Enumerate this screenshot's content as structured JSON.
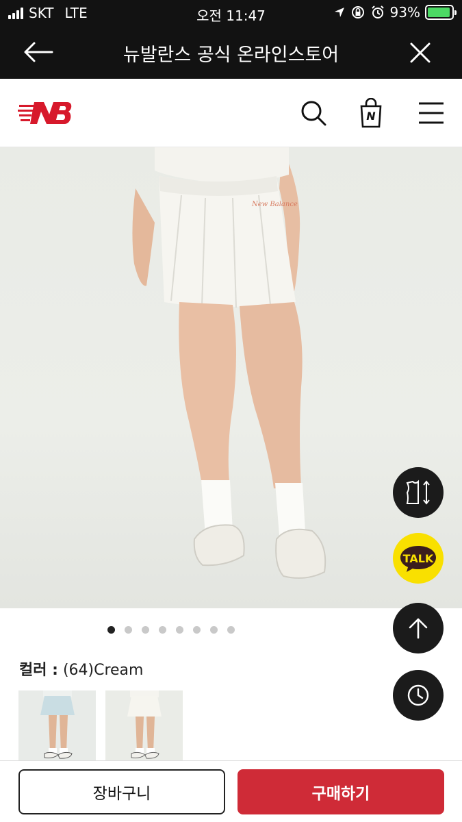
{
  "status_bar": {
    "carrier": "SKT",
    "network": "LTE",
    "time": "오전 11:47",
    "battery_percent": "93%",
    "battery_level": 0.93,
    "battery_color": "#4cd964"
  },
  "webview": {
    "title": "뉴발란스 공식 온라인스토어",
    "back_icon": "arrow-left-icon",
    "close_icon": "close-icon"
  },
  "header": {
    "logo": "new-balance-logo",
    "brand_color": "#d7192b",
    "icons": [
      "search-icon",
      "shopping-bag-icon",
      "menu-icon"
    ],
    "bag_letter": "N"
  },
  "gallery": {
    "total_images": 8,
    "active_index": 0
  },
  "floating_buttons": {
    "size_guide_icon": "size-guide-icon",
    "kakao_label": "TALK",
    "top_icon": "arrow-up-icon",
    "recent_icon": "clock-icon"
  },
  "color": {
    "label": "컬러 :",
    "value": "(64)Cream"
  },
  "swatches": [
    {
      "name": "light-blue",
      "color": "#cfe0e6"
    },
    {
      "name": "cream",
      "color": "#f3f1e8"
    }
  ],
  "actions": {
    "cart_label": "장바구니",
    "buy_label": "구매하기",
    "buy_color": "#cf2b37"
  }
}
